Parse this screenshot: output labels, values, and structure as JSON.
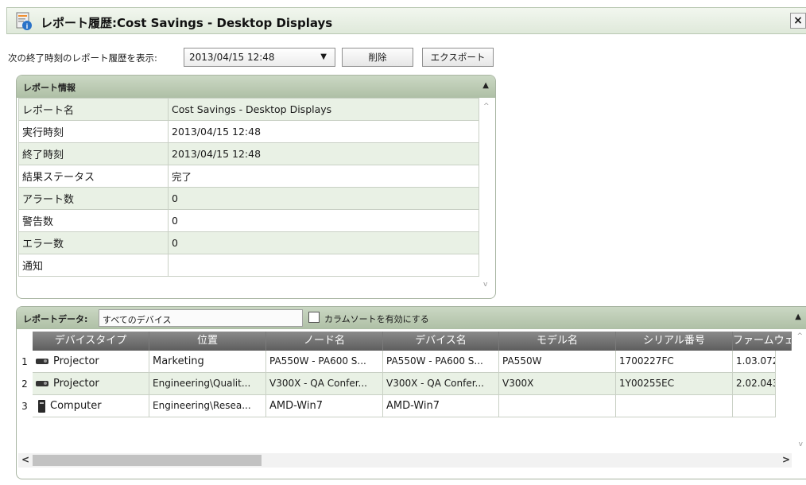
{
  "window": {
    "title": "レポート履歴:Cost Savings - Desktop Displays",
    "close_label": "×"
  },
  "toolbar": {
    "label": "次の終了時刻のレポート履歴を表示:",
    "selected_time": "2013/04/15 12:48",
    "delete_label": "削除",
    "export_label": "エクスポート"
  },
  "info_panel": {
    "header": "レポート情報",
    "rows": [
      {
        "key": "レポート名",
        "value": "Cost Savings - Desktop Displays"
      },
      {
        "key": "実行時刻",
        "value": "2013/04/15 12:48"
      },
      {
        "key": "終了時刻",
        "value": "2013/04/15 12:48"
      },
      {
        "key": "結果ステータス",
        "value": "完了"
      },
      {
        "key": "アラート数",
        "value": "0"
      },
      {
        "key": "警告数",
        "value": "0"
      },
      {
        "key": "エラー数",
        "value": "0"
      },
      {
        "key": "通知",
        "value": ""
      }
    ]
  },
  "data_panel": {
    "header": "レポートデータ:",
    "filter_value": "すべてのデバイス",
    "sort_label": "カラムソートを有効にする",
    "columns": [
      "デバイスタイプ",
      "位置",
      "ノード名",
      "デバイス名",
      "モデル名",
      "シリアル番号",
      "ファームウェ"
    ],
    "rows": [
      {
        "num": "1",
        "icon": "projector-icon",
        "cells": [
          "Projector",
          "Marketing",
          "PA550W - PA600 S...",
          "PA550W - PA600 S...",
          "PA550W",
          "1700227FC",
          "1.03.072"
        ]
      },
      {
        "num": "2",
        "icon": "projector-icon",
        "cells": [
          "Projector",
          "Engineering\\Qualit...",
          "V300X - QA Confer...",
          "V300X - QA Confer...",
          "V300X",
          "1Y00255EC",
          "2.02.043"
        ]
      },
      {
        "num": "3",
        "icon": "computer-icon",
        "cells": [
          "Computer",
          "Engineering\\Resea...",
          "AMD-Win7",
          "AMD-Win7",
          "",
          "",
          ""
        ]
      }
    ]
  }
}
